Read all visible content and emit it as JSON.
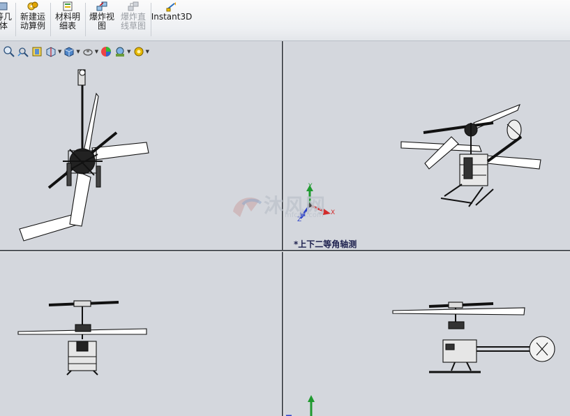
{
  "ribbon": {
    "cut_label": "等几\n体",
    "motion_label": "新建运\n动算例",
    "bom_label": "材料明\n细表",
    "explode_label": "爆炸视\n图",
    "explode_line_label": "爆炸直\n线草图",
    "instant3d_label": "Instant3D"
  },
  "hud_icons": [
    "zoom-to-fit-icon",
    "zoom-area-icon",
    "previous-view-icon",
    "section-view-icon",
    "view-orientation-icon",
    "display-style-icon",
    "hide-show-icon",
    "edit-appearance-icon",
    "apply-scene-icon",
    "view-settings-icon"
  ],
  "viewport": {
    "isometric_label": "*上下二等角轴测"
  },
  "triad": {
    "x": "X",
    "y": "Y",
    "z": "Z"
  },
  "watermark": {
    "text": "沐风网",
    "url": "mfcad.com"
  },
  "colors": {
    "viewport_bg": "#d4d7dd",
    "divider": "#50545a",
    "label_color": "#1c1f4d",
    "triad_x": "#d22b2b",
    "triad_y": "#1f9a2f",
    "triad_z": "#2a3fc8"
  }
}
